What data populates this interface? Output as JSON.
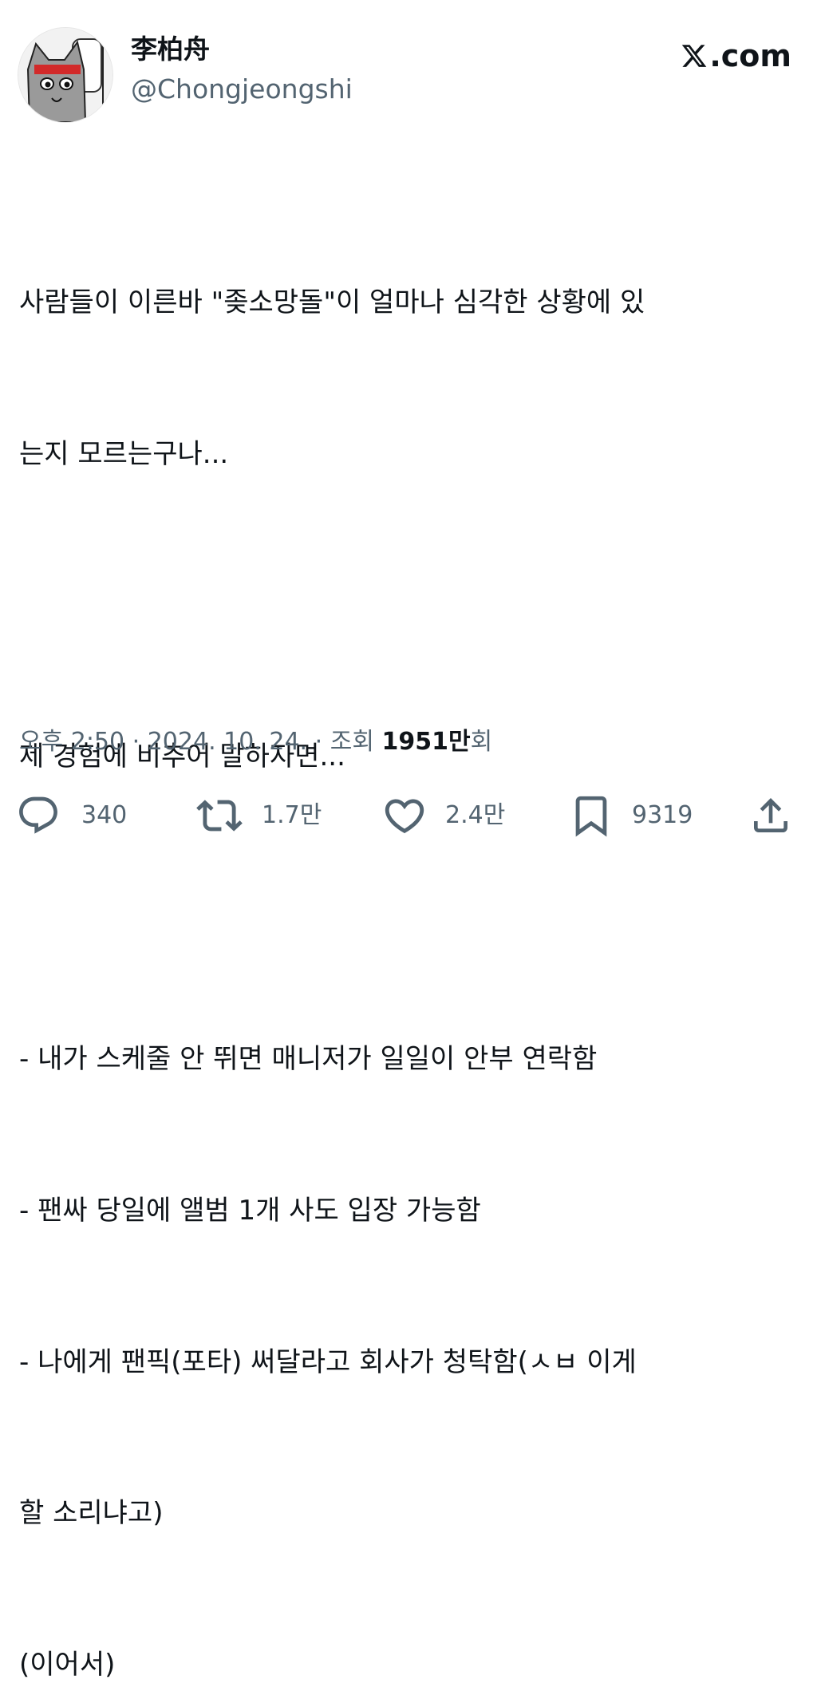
{
  "author": {
    "display_name": "李柏舟",
    "handle": "@Chongjeongshi",
    "avatar_caption": "투쟁을 해야 한다."
  },
  "site": {
    "brand": ".com",
    "icon": "x-logo-icon"
  },
  "tweet": {
    "lines": [
      "사람들이 이른바 \"좆소망돌\"이 얼마나 심각한 상황에 있",
      "는지 모르는구나...",
      "",
      "제 경험에 비추어 말하자면...",
      "",
      "- 내가 스케줄 안 뛰면 매니저가 일일이 안부 연락함",
      "- 팬싸 당일에 앨범 1개 사도 입장 가능함",
      "- 나에게 팬픽(포타) 써달라고 회사가 청탁함(ㅅㅂ 이게",
      "할 소리냐고)",
      "(이어서)"
    ]
  },
  "meta": {
    "time": "오후 2:50",
    "separator": " · ",
    "date": "2024. 10. 24.",
    "views_label": "조회",
    "views_count": "1951만",
    "views_suffix": "회"
  },
  "actions": {
    "reply": {
      "icon": "reply-icon",
      "count": "340"
    },
    "retweet": {
      "icon": "retweet-icon",
      "count": "1.7만"
    },
    "like": {
      "icon": "heart-icon",
      "count": "2.4만"
    },
    "bookmark": {
      "icon": "bookmark-icon",
      "count": "9319"
    },
    "share": {
      "icon": "share-icon"
    }
  },
  "colors": {
    "text": "#0f1419",
    "secondary": "#536471",
    "background": "#ffffff"
  }
}
